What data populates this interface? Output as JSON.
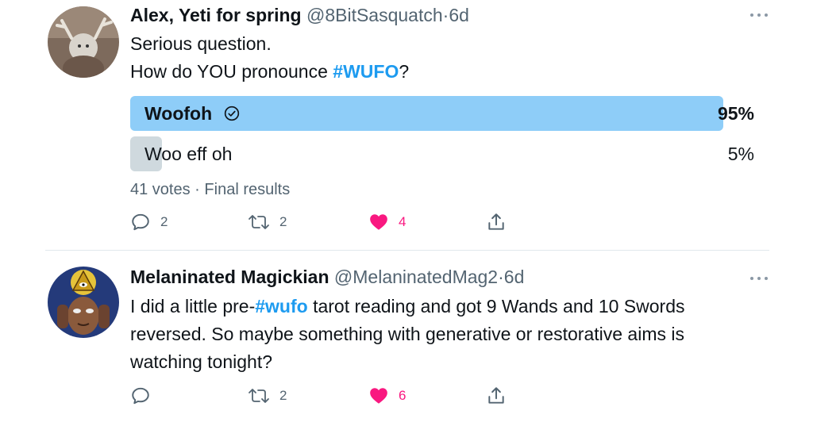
{
  "tweets": [
    {
      "author_name": "Alex, Yeti for spring",
      "author_handle": "@8BitSasquatch",
      "dot": "·",
      "time": "6d",
      "text_line1": "Serious question.",
      "text_line2_prefix": "How do YOU pronounce ",
      "hashtag": "#WUFO",
      "text_line2_suffix": "?",
      "poll": {
        "options": [
          {
            "label": "Woofoh",
            "percent_text": "95%",
            "percent": 95,
            "winner": true
          },
          {
            "label": "Woo eff oh",
            "percent_text": "5%",
            "percent": 5,
            "winner": false
          }
        ],
        "votes_text": "41 votes",
        "separator": "·",
        "status_text": "Final results"
      },
      "actions": {
        "replies": "2",
        "retweets": "2",
        "likes": "4"
      }
    },
    {
      "author_name": "Melaninated Magickian",
      "author_handle": "@MelaninatedMag2",
      "dot": "·",
      "time": "6d",
      "text_line1_prefix": "I did a little pre-",
      "hashtag": "#wufo",
      "text_line1_suffix": " tarot reading and got 9 Wands and 10 Swords",
      "text_line2": "reversed. So maybe something with generative or restorative aims is",
      "text_line3": "watching tonight?",
      "actions": {
        "replies": "",
        "retweets": "2",
        "likes": "6"
      }
    }
  ],
  "colors": {
    "accent": "#1d9bf0",
    "poll_winner": "#8ecdf8",
    "poll_other": "#cfd9de",
    "like": "#f91880",
    "muted": "#536471"
  },
  "icons": [
    "reply-icon",
    "retweet-icon",
    "like-icon",
    "share-icon",
    "more-icon",
    "check-circle-icon"
  ]
}
